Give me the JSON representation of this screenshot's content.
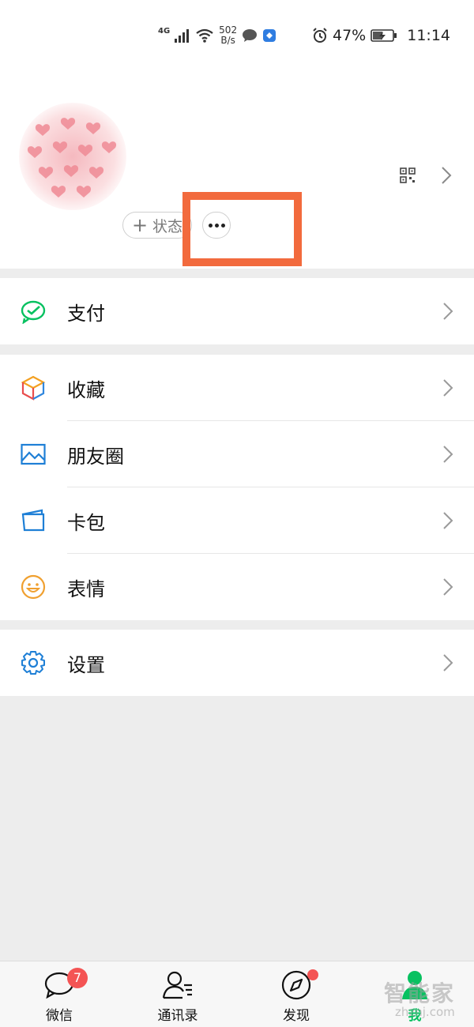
{
  "status_bar": {
    "network": "4G",
    "speed_value": "502",
    "speed_unit": "B/s",
    "battery": "47%",
    "time": "11:14"
  },
  "profile": {
    "status_button_label": "状态",
    "more_button": "more-icon"
  },
  "menu": {
    "pay": {
      "label": "支付",
      "icon": "wechat-pay-icon",
      "color": "#07c160"
    },
    "favorites": {
      "label": "收藏",
      "icon": "cube-icon"
    },
    "moments": {
      "label": "朋友圈",
      "icon": "picture-icon",
      "color": "#1e7fd6"
    },
    "cards": {
      "label": "卡包",
      "icon": "wallet-icon",
      "color": "#1e7fd6"
    },
    "stickers": {
      "label": "表情",
      "icon": "smile-icon",
      "color": "#f0a030"
    },
    "settings": {
      "label": "设置",
      "icon": "gear-icon",
      "color": "#1e7fd6"
    }
  },
  "tabbar": {
    "chats": {
      "label": "微信",
      "badge": "7"
    },
    "contacts": {
      "label": "通讯录"
    },
    "discover": {
      "label": "发现"
    },
    "me": {
      "label": "我"
    }
  },
  "watermark": {
    "text": "智能家",
    "url": "zhznj.com"
  },
  "colors": {
    "accent": "#07c160",
    "highlight": "#f26a3d",
    "badge": "#f45454"
  }
}
